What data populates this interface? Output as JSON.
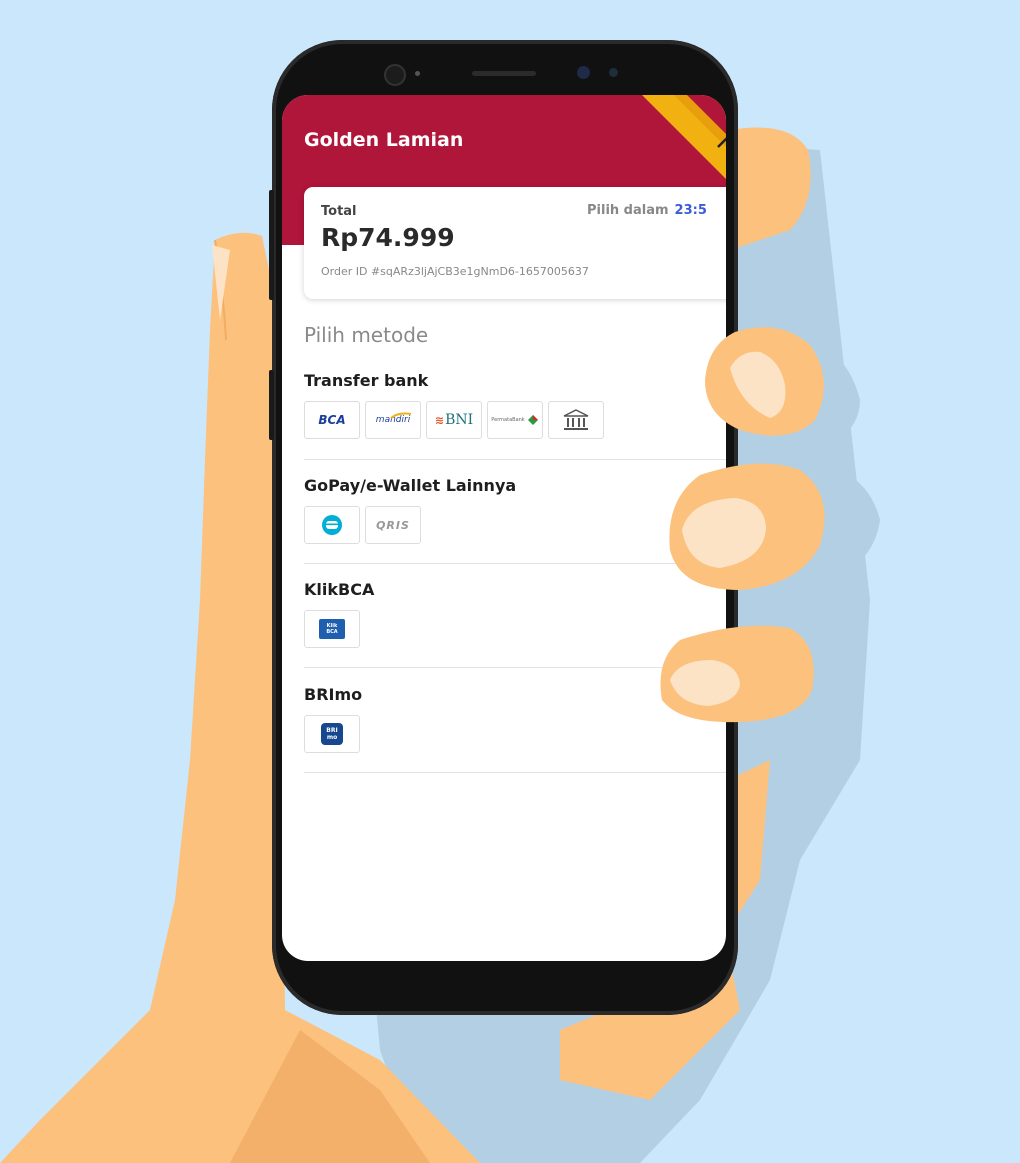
{
  "app": {
    "title": "Golden Lamian",
    "brand_color": "#b0153a",
    "accent_color": "#f0b111"
  },
  "summary": {
    "total_label": "Total",
    "amount": "Rp74.999",
    "timer_label": "Pilih dalam",
    "timer_value": "23:5",
    "order_id": "Order ID #sqARz3ljAjCB3e1gNmD6-1657005637"
  },
  "methods": {
    "heading": "Pilih metode",
    "groups": [
      {
        "title": "Transfer bank",
        "logos": [
          {
            "label": "BCA",
            "icon": "bca-logo"
          },
          {
            "label": "mandiri",
            "icon": "mandiri-logo"
          },
          {
            "label": "BNI",
            "icon": "bni-logo"
          },
          {
            "label": "PermataBank",
            "icon": "permata-logo"
          },
          {
            "label": "",
            "icon": "bank-building-icon"
          }
        ]
      },
      {
        "title": "GoPay/e-Wallet Lainnya",
        "logos": [
          {
            "label": "",
            "icon": "gopay-icon"
          },
          {
            "label": "QRIS",
            "icon": "qris-logo"
          }
        ]
      },
      {
        "title": "KlikBCA",
        "logos": [
          {
            "label": "Klik BCA",
            "icon": "klikbca-logo"
          }
        ]
      },
      {
        "title": "BRImo",
        "logos": [
          {
            "label": "BRI mo",
            "icon": "brimo-logo"
          }
        ]
      }
    ]
  }
}
